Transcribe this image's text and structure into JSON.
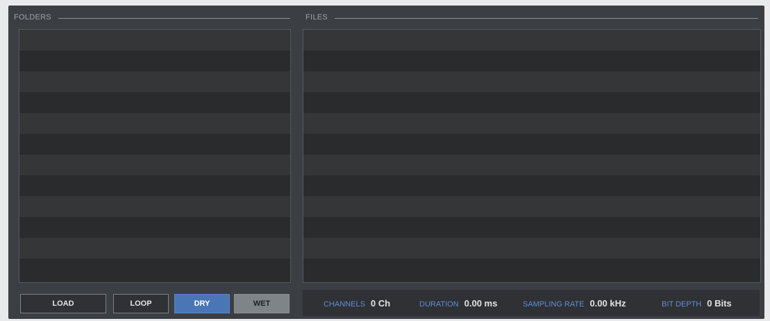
{
  "folders": {
    "title": "FOLDERS",
    "row_count": 12
  },
  "files": {
    "title": "FILES",
    "row_count": 12
  },
  "buttons": {
    "load": "LOAD",
    "loop": "LOOP",
    "dry": "DRY",
    "wet": "WET"
  },
  "info": {
    "channels_label": "CHANNELS",
    "channels_value": "0 Ch",
    "duration_label": "DURATION",
    "duration_value": "0.00 ms",
    "sampling_label": "SAMPLING RATE",
    "sampling_value": "0.00 kHz",
    "bitdepth_label": "BIT DEPTH",
    "bitdepth_value": "0 Bits"
  },
  "colors": {
    "accent": "#4a76b6",
    "label_blue": "#5f8fd6",
    "panel_bg": "#3b3e43"
  }
}
